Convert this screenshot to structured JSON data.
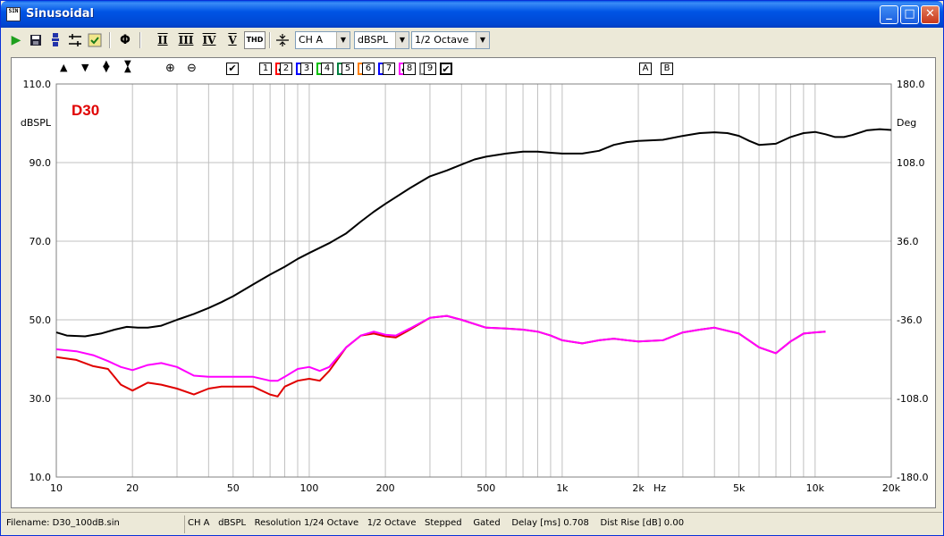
{
  "window": {
    "title": "Sinusoidal",
    "app_icon_text": "SIN"
  },
  "title_buttons": {
    "min": "_",
    "max": "□",
    "close": "✕"
  },
  "toolbar": {
    "icons": [
      "play-icon",
      "save-icon",
      "device-icon",
      "marker-icon",
      "check-icon",
      "phase-icon"
    ],
    "harmonics": [
      "II",
      "III",
      "IV",
      "V"
    ],
    "thd_label": "THD",
    "channel": "CH A",
    "unit": "dBSPL",
    "smoothing": "1/2 Octave"
  },
  "plot_controls": {
    "checkbox_main": "✔",
    "curves": [
      {
        "num": "1",
        "checked": true,
        "color": "#ff0000"
      },
      {
        "num": "2",
        "checked": false,
        "color": "#0000ff"
      },
      {
        "num": "3",
        "checked": false,
        "color": "#00c000"
      },
      {
        "num": "4",
        "checked": false,
        "color": "#008040"
      },
      {
        "num": "5",
        "checked": false,
        "color": "#ff8000"
      },
      {
        "num": "6",
        "checked": false,
        "color": "#0000ff"
      },
      {
        "num": "7",
        "checked": true,
        "color": "#ff00ff"
      },
      {
        "num": "8",
        "checked": false,
        "color": "#808080"
      },
      {
        "num": "9",
        "checked": true,
        "color": "#000000"
      }
    ],
    "cursors": [
      "A",
      "B"
    ]
  },
  "status": {
    "filename": "Filename: D30_100dB.sin",
    "channel": "CH A",
    "unit": "dBSPL",
    "resolution": "Resolution 1/24 Octave",
    "smoothing": "1/2 Octave",
    "mode": "Stepped",
    "gated": "Gated",
    "delay": "Delay [ms] 0.708",
    "dist_rise": "Dist Rise [dB] 0.00"
  },
  "chart_data": {
    "type": "line",
    "title": "D30",
    "xlabel": "Hz",
    "ylabel": "dBSPL",
    "y2label": "Deg",
    "x_scale": "log",
    "xlim": [
      10,
      20000
    ],
    "ylim": [
      10,
      110
    ],
    "y2lim": [
      -180,
      180
    ],
    "x_ticks": [
      10,
      20,
      50,
      100,
      200,
      500,
      1000,
      2000,
      5000,
      10000,
      20000
    ],
    "x_tick_labels": [
      "10",
      "20",
      "50",
      "100",
      "200",
      "500",
      "1k",
      "2k",
      "5k",
      "10k",
      "20k"
    ],
    "y_ticks": [
      "10.0",
      "30.0",
      "50.0",
      "70.0",
      "90.0",
      "110.0"
    ],
    "y2_ticks": [
      "-180.0",
      "-108.0",
      "-36.0",
      "36.0",
      "108.0",
      "180.0"
    ],
    "grid": true,
    "series": [
      {
        "color": "#e00000",
        "axis": "left",
        "points": [
          [
            10,
            40.5
          ],
          [
            12,
            39.8
          ],
          [
            14,
            38.2
          ],
          [
            16,
            37.5
          ],
          [
            18,
            33.5
          ],
          [
            20,
            32
          ],
          [
            23,
            34
          ],
          [
            26,
            33.5
          ],
          [
            30,
            32.5
          ],
          [
            35,
            31
          ],
          [
            40,
            32.5
          ],
          [
            45,
            33
          ],
          [
            50,
            33
          ],
          [
            60,
            33
          ],
          [
            70,
            31
          ],
          [
            75,
            30.5
          ],
          [
            80,
            33
          ],
          [
            90,
            34.5
          ],
          [
            100,
            35
          ],
          [
            110,
            34.5
          ],
          [
            120,
            37
          ],
          [
            140,
            43
          ],
          [
            160,
            46
          ],
          [
            180,
            46.5
          ],
          [
            200,
            45.8
          ],
          [
            220,
            45.5
          ],
          [
            250,
            47.5
          ],
          [
            300,
            50.5
          ],
          [
            350,
            51
          ],
          [
            400,
            50
          ],
          [
            500,
            48
          ],
          [
            600,
            47.8
          ],
          [
            700,
            47.5
          ],
          [
            800,
            47
          ],
          [
            900,
            46
          ],
          [
            1000,
            44.8
          ],
          [
            1200,
            44
          ],
          [
            1400,
            44.8
          ],
          [
            1600,
            45.2
          ],
          [
            1800,
            44.8
          ],
          [
            2000,
            44.5
          ],
          [
            2500,
            44.8
          ],
          [
            3000,
            46.8
          ],
          [
            3500,
            47.5
          ],
          [
            4000,
            48
          ],
          [
            5000,
            46.5
          ],
          [
            6000,
            43
          ],
          [
            7000,
            41.5
          ],
          [
            8000,
            44.5
          ],
          [
            9000,
            46.5
          ],
          [
            10000,
            46.8
          ],
          [
            11000,
            47
          ]
        ]
      },
      {
        "color": "#ff00ff",
        "axis": "left",
        "points": [
          [
            10,
            42.5
          ],
          [
            12,
            42
          ],
          [
            14,
            41
          ],
          [
            16,
            39.5
          ],
          [
            18,
            38
          ],
          [
            20,
            37.2
          ],
          [
            23,
            38.5
          ],
          [
            26,
            39
          ],
          [
            30,
            38
          ],
          [
            35,
            35.8
          ],
          [
            40,
            35.5
          ],
          [
            45,
            35.5
          ],
          [
            50,
            35.5
          ],
          [
            60,
            35.5
          ],
          [
            70,
            34.5
          ],
          [
            75,
            34.5
          ],
          [
            80,
            35.5
          ],
          [
            90,
            37.5
          ],
          [
            100,
            38
          ],
          [
            110,
            37
          ],
          [
            120,
            38
          ],
          [
            140,
            43
          ],
          [
            160,
            46
          ],
          [
            180,
            47
          ],
          [
            200,
            46.2
          ],
          [
            220,
            46
          ],
          [
            250,
            47.8
          ],
          [
            300,
            50.5
          ],
          [
            350,
            51
          ],
          [
            400,
            50
          ],
          [
            500,
            48
          ],
          [
            600,
            47.8
          ],
          [
            700,
            47.5
          ],
          [
            800,
            47
          ],
          [
            900,
            46
          ],
          [
            1000,
            44.8
          ],
          [
            1200,
            44
          ],
          [
            1400,
            44.8
          ],
          [
            1600,
            45.2
          ],
          [
            1800,
            44.8
          ],
          [
            2000,
            44.5
          ],
          [
            2500,
            44.8
          ],
          [
            3000,
            46.8
          ],
          [
            3500,
            47.5
          ],
          [
            4000,
            48
          ],
          [
            5000,
            46.5
          ],
          [
            6000,
            43
          ],
          [
            7000,
            41.5
          ],
          [
            8000,
            44.5
          ],
          [
            9000,
            46.5
          ],
          [
            10000,
            46.8
          ],
          [
            11000,
            47
          ]
        ]
      },
      {
        "color": "#000000",
        "axis": "left",
        "points": [
          [
            10,
            46.8
          ],
          [
            11,
            46
          ],
          [
            13,
            45.8
          ],
          [
            15,
            46.5
          ],
          [
            17,
            47.5
          ],
          [
            19,
            48.2
          ],
          [
            21,
            48
          ],
          [
            23,
            48
          ],
          [
            26,
            48.5
          ],
          [
            30,
            50
          ],
          [
            35,
            51.5
          ],
          [
            40,
            53
          ],
          [
            45,
            54.5
          ],
          [
            50,
            56
          ],
          [
            60,
            59
          ],
          [
            70,
            61.5
          ],
          [
            80,
            63.5
          ],
          [
            90,
            65.5
          ],
          [
            100,
            67
          ],
          [
            120,
            69.5
          ],
          [
            140,
            72
          ],
          [
            160,
            75
          ],
          [
            180,
            77.5
          ],
          [
            200,
            79.5
          ],
          [
            250,
            83.5
          ],
          [
            300,
            86.5
          ],
          [
            350,
            88
          ],
          [
            400,
            89.5
          ],
          [
            450,
            90.8
          ],
          [
            500,
            91.5
          ],
          [
            600,
            92.3
          ],
          [
            700,
            92.8
          ],
          [
            800,
            92.8
          ],
          [
            900,
            92.5
          ],
          [
            1000,
            92.3
          ],
          [
            1200,
            92.3
          ],
          [
            1400,
            93
          ],
          [
            1600,
            94.5
          ],
          [
            1800,
            95.2
          ],
          [
            2000,
            95.5
          ],
          [
            2500,
            95.8
          ],
          [
            3000,
            96.8
          ],
          [
            3500,
            97.5
          ],
          [
            4000,
            97.7
          ],
          [
            4500,
            97.5
          ],
          [
            5000,
            96.8
          ],
          [
            5500,
            95.5
          ],
          [
            6000,
            94.5
          ],
          [
            7000,
            94.8
          ],
          [
            8000,
            96.5
          ],
          [
            9000,
            97.5
          ],
          [
            10000,
            97.8
          ],
          [
            11000,
            97.2
          ],
          [
            12000,
            96.5
          ],
          [
            13000,
            96.5
          ],
          [
            14000,
            97
          ],
          [
            16000,
            98.2
          ],
          [
            18000,
            98.5
          ],
          [
            20000,
            98.3
          ]
        ]
      }
    ]
  }
}
